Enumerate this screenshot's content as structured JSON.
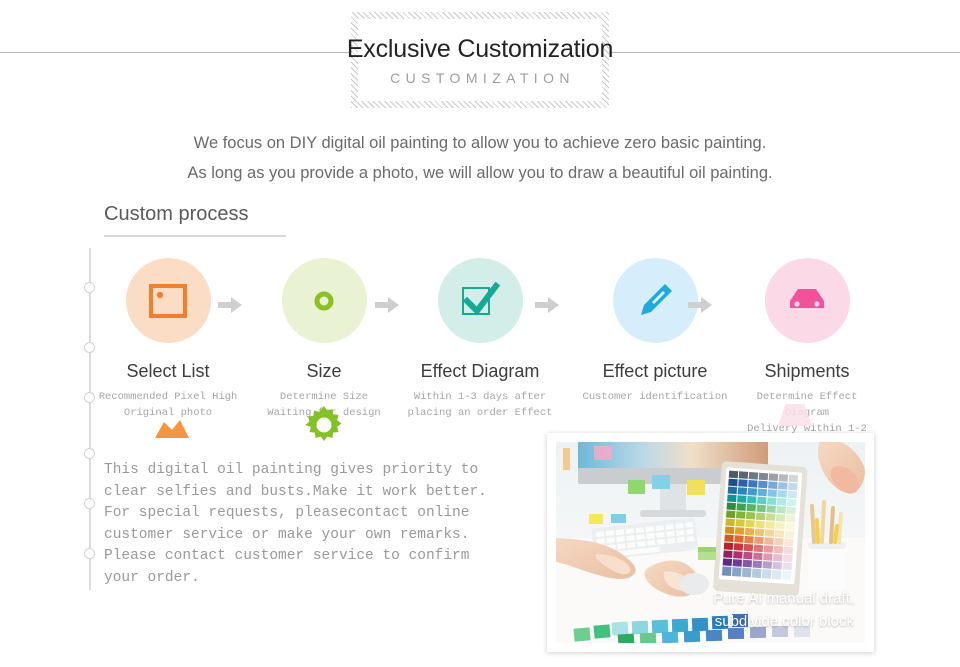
{
  "header": {
    "title_main": "Exclusive Customization",
    "title_sub": "CUSTOMIZATION"
  },
  "intro": {
    "line1": "We focus on DIY digital oil painting to allow you to achieve zero basic painting.",
    "line2": "As long as you provide a photo, we will allow you to draw a beautiful oil painting."
  },
  "section": {
    "heading": "Custom process"
  },
  "process": {
    "arrow_glyph": "➜",
    "steps": [
      {
        "title": "Select List",
        "desc_line1": "Recommended Pixel High",
        "desc_line2": "Original photo",
        "icon": "image-icon",
        "circle_color": "#fbddc6",
        "icon_color": "#f08030"
      },
      {
        "title": "Size",
        "desc_line1": "Determine Size",
        "desc_line2": "Waiting for design",
        "icon": "ring-icon",
        "circle_color": "#e9f2d3",
        "icon_color": "#8cc024"
      },
      {
        "title": "Effect Diagram",
        "desc_line1": "Within 1-3 days after",
        "desc_line2": "placing an order Effect",
        "icon": "checkbox-icon",
        "circle_color": "#d3eee9",
        "icon_color": "#18a898"
      },
      {
        "title": "Effect picture",
        "desc_line1": "Customer identification",
        "desc_line2": "",
        "icon": "pen-icon",
        "circle_color": "#d6eefb",
        "icon_color": "#1fa9dd"
      },
      {
        "title": "Shipments",
        "desc_line1": "Determine Effect Diagram",
        "desc_line2": "Delivery within 1-2 days",
        "icon": "car-icon",
        "circle_color": "#fbd9e7",
        "icon_color": "#ef549a"
      }
    ]
  },
  "decorations": {
    "mountain": "mountain-shape",
    "gear": "gear-shape",
    "trapezoid": "trapezoid-shape"
  },
  "body_copy": {
    "line1": "This digital oil painting gives priority to",
    "line2": "clear selfies and busts.Make it work better.",
    "line3": "For special requests, pleasecontact online",
    "line4": "customer service or make your own remarks.",
    "line5": "Please contact customer service to confirm",
    "line6": "your order."
  },
  "photo": {
    "caption_line1": "Pure AI manual draft,",
    "caption_line2": "subdivide color block",
    "alt": "designer-at-desk-with-color-palette-tablet"
  },
  "colors": {
    "rule": "#b9b9b9",
    "hatch": "#c9c9c9",
    "text_dark": "#232323",
    "text_gray": "#6b6b6b",
    "text_light": "#a6a6a6"
  }
}
